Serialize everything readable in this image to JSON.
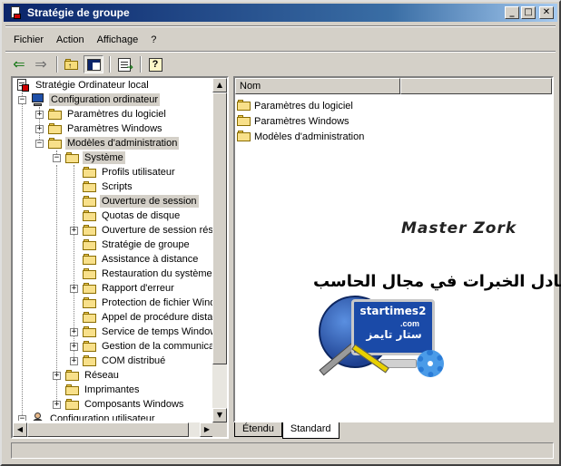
{
  "window": {
    "title": "Stratégie de groupe"
  },
  "caption_buttons": {
    "minimize": "_",
    "maximize": "□",
    "close": "✕"
  },
  "menu": [
    "Fichier",
    "Action",
    "Affichage",
    "?"
  ],
  "toolbar": [
    "back-arrow-icon",
    "forward-arrow-icon",
    "up-folder-icon",
    "show-hide-tree-icon",
    "export-list-icon",
    "help-icon"
  ],
  "tree": {
    "root": "Stratégie Ordinateur local",
    "items": [
      "Configuration ordinateur",
      "Paramètres du logiciel",
      "Paramètres Windows",
      "Modèles d'administration",
      "Système",
      "Profils utilisateur",
      "Scripts",
      "Ouverture de session",
      "Quotas de disque",
      "Ouverture de session rése",
      "Stratégie de groupe",
      "Assistance à distance",
      "Restauration du système",
      "Rapport d'erreur",
      "Protection de fichier Wind",
      "Appel de procédure distar",
      "Service de temps Window",
      "Gestion de la communicati",
      "COM distribué",
      "Réseau",
      "Imprimantes",
      "Composants Windows",
      "Configuration utilisateur"
    ]
  },
  "list": {
    "header": "Nom",
    "items": [
      "Paramètres du logiciel",
      "Paramètres Windows",
      "Modèles d'administration"
    ]
  },
  "tabs": [
    "Étendu",
    "Standard"
  ],
  "watermark": {
    "signature": "Master Zork",
    "arabic_slogan": "تبادل الخبرات في مجال الحاسب",
    "brand": "startimes2",
    "brand_domain": ".com",
    "brand_arabic": "ستار تايمز"
  }
}
